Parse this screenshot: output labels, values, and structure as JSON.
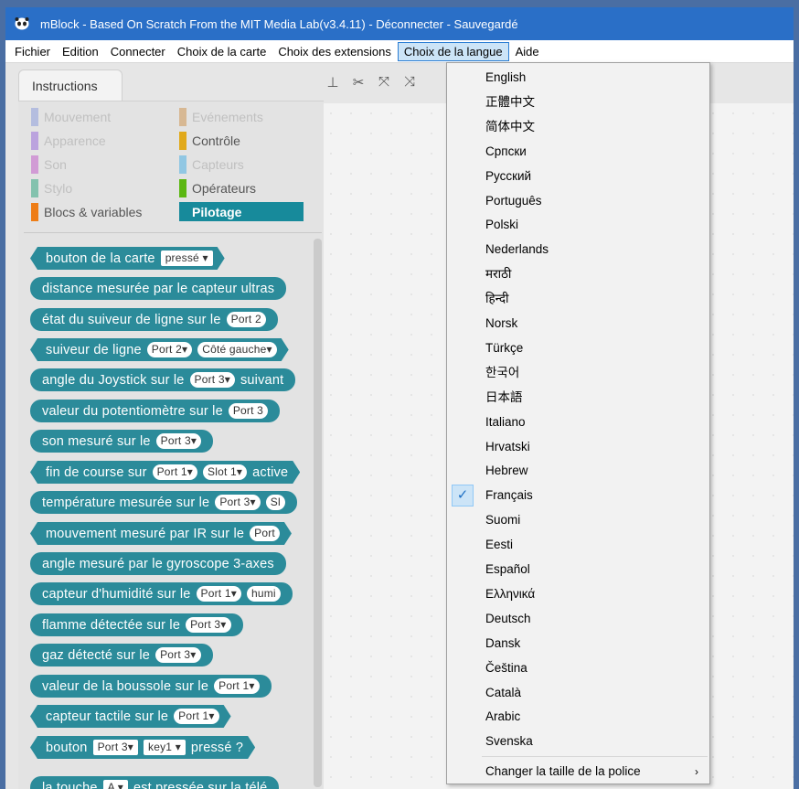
{
  "window": {
    "title": "mBlock - Based On Scratch From the MIT Media Lab(v3.4.11) - Déconnecter - Sauvegardé"
  },
  "menubar": {
    "items": [
      {
        "label": "Fichier"
      },
      {
        "label": "Edition"
      },
      {
        "label": "Connecter"
      },
      {
        "label": "Choix de la carte"
      },
      {
        "label": "Choix des extensions"
      },
      {
        "label": "Choix de la langue",
        "active": true
      },
      {
        "label": "Aide"
      }
    ]
  },
  "tabs": {
    "instructions": "Instructions"
  },
  "categories": [
    {
      "label": "Mouvement",
      "color": "#7b8fd9"
    },
    {
      "label": "Evénements",
      "color": "#c88330"
    },
    {
      "label": "Apparence",
      "color": "#8a55d7"
    },
    {
      "label": "Contrôle",
      "color": "#e1a91a"
    },
    {
      "label": "Son",
      "color": "#bb42c3"
    },
    {
      "label": "Capteurs",
      "color": "#2ca5e2"
    },
    {
      "label": "Stylo",
      "color": "#0e9a6c"
    },
    {
      "label": "Opérateurs",
      "color": "#5cb712"
    },
    {
      "label": "Blocs & variables",
      "color": "#ee7d16"
    },
    {
      "label": "Pilotage",
      "color": "#178a9b",
      "selected": true
    }
  ],
  "blocks": [
    {
      "pre": "bouton de la carte",
      "d1": "pressé ▾",
      "post": ""
    },
    {
      "pre": "distance mesurée par le capteur ultras",
      "d1": "",
      "post": ""
    },
    {
      "pre": "état du suiveur de ligne sur le",
      "d1": "Port 2",
      "post": ""
    },
    {
      "pre": "suiveur de ligne",
      "d1": "Port 2▾",
      "d2": "Côté gauche▾",
      "post": ""
    },
    {
      "pre": "angle du Joystick sur le",
      "d1": "Port 3▾",
      "post": "suivant"
    },
    {
      "pre": "valeur du potentiomètre sur le",
      "d1": "Port 3",
      "post": ""
    },
    {
      "pre": "son mesuré sur le",
      "d1": "Port 3▾",
      "post": ""
    },
    {
      "pre": "fin de course sur",
      "d1": "Port 1▾",
      "d2": "Slot 1▾",
      "post": "active"
    },
    {
      "pre": "température mesurée sur le",
      "d1": "Port 3▾",
      "d2": "Sl",
      "post": ""
    },
    {
      "pre": "mouvement mesuré par IR sur le",
      "d1": "Port",
      "post": ""
    },
    {
      "pre": "angle mesuré par le gyroscope 3-axes",
      "d1": "",
      "post": ""
    },
    {
      "pre": "capteur d'humidité sur le",
      "d1": "Port 1▾",
      "d2": "humi",
      "post": ""
    },
    {
      "pre": "flamme détectée sur le",
      "d1": "Port 3▾",
      "post": ""
    },
    {
      "pre": "gaz détecté sur le",
      "d1": "Port 3▾",
      "post": ""
    },
    {
      "pre": "valeur de la boussole sur le",
      "d1": "Port 1▾",
      "post": ""
    },
    {
      "pre": "capteur tactile sur le",
      "d1": "Port 1▾",
      "post": ""
    },
    {
      "pre": "bouton",
      "d1": "Port 3▾",
      "d2": "key1 ▾",
      "post": "pressé ?"
    },
    {
      "pre": "la touche",
      "d1": "A ▾",
      "post": "est pressée sur la télé"
    }
  ],
  "language_menu": {
    "items": [
      {
        "label": "English"
      },
      {
        "label": "正體中文"
      },
      {
        "label": "简体中文"
      },
      {
        "label": "Српски"
      },
      {
        "label": "Русский"
      },
      {
        "label": "Português"
      },
      {
        "label": "Polski"
      },
      {
        "label": "Nederlands"
      },
      {
        "label": "मराठी"
      },
      {
        "label": "हिन्दी"
      },
      {
        "label": "Norsk"
      },
      {
        "label": "Türkçe"
      },
      {
        "label": "한국어"
      },
      {
        "label": "日本語"
      },
      {
        "label": "Italiano"
      },
      {
        "label": "Hrvatski"
      },
      {
        "label": "Hebrew"
      },
      {
        "label": "Français",
        "checked": true
      },
      {
        "label": "Suomi"
      },
      {
        "label": "Eesti"
      },
      {
        "label": "Español"
      },
      {
        "label": "Ελληνικά"
      },
      {
        "label": "Deutsch"
      },
      {
        "label": "Dansk"
      },
      {
        "label": "Čeština"
      },
      {
        "label": "Català"
      },
      {
        "label": "Arabic"
      },
      {
        "label": "Svenska"
      }
    ],
    "check_mark": "✓",
    "font_size_item": "Changer la taille de la police",
    "submenu_arrow": "›"
  },
  "icons": {
    "app": "panda-icon",
    "tools": [
      "stamp-icon",
      "cut-icon",
      "grow-icon",
      "shrink-icon"
    ]
  }
}
